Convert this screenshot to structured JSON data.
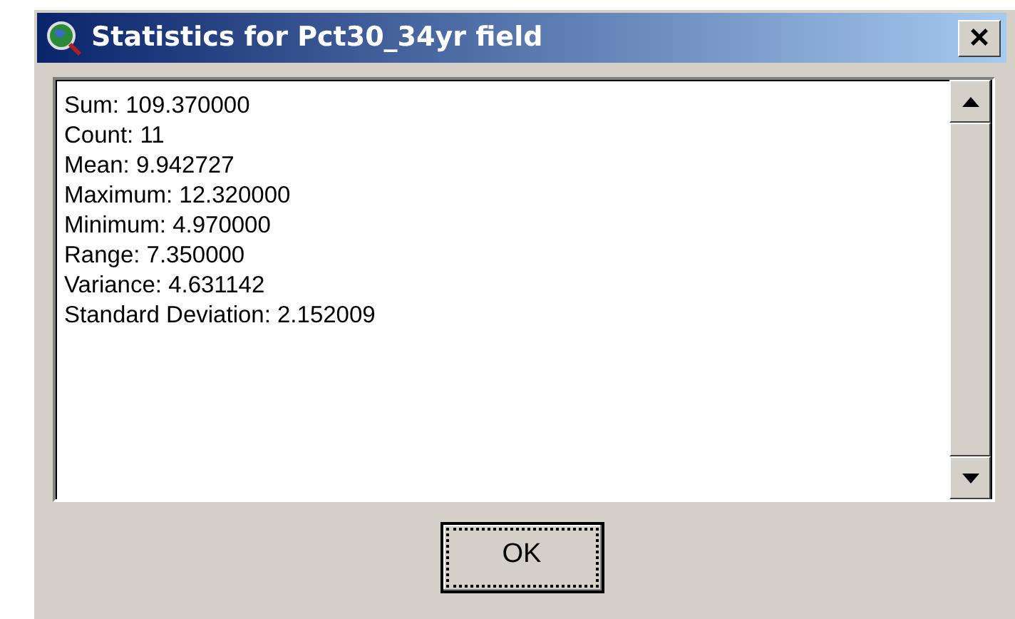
{
  "window": {
    "title": "Statistics for Pct30_34yr field",
    "close": "×"
  },
  "lines": [
    "Sum: 109.370000",
    "Count: 11",
    "Mean: 9.942727",
    "Maximum: 12.320000",
    "Minimum: 4.970000",
    "Range: 7.350000",
    "Variance: 4.631142",
    "Standard Deviation: 2.152009"
  ],
  "buttons": [
    {
      "label": "OK",
      "focused": true
    }
  ]
}
